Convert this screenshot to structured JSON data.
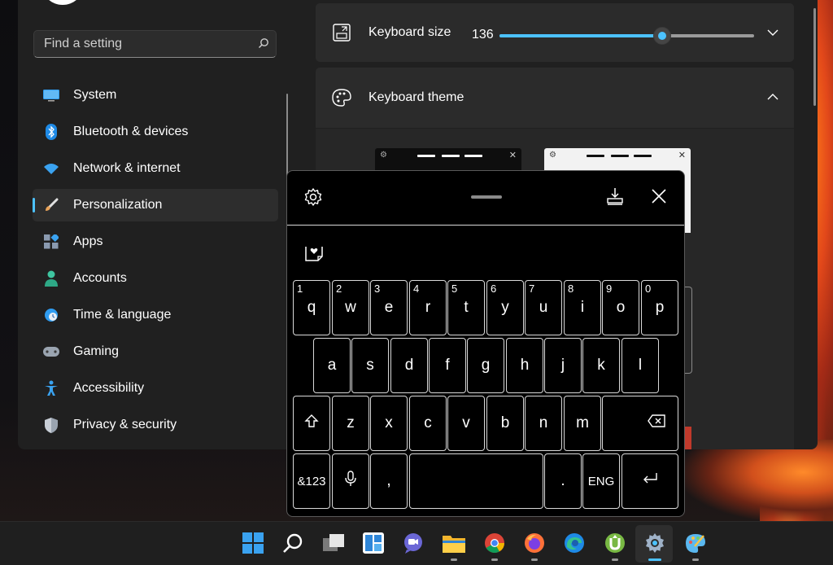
{
  "search": {
    "placeholder": "Find a setting"
  },
  "nav": {
    "items": [
      {
        "label": "System",
        "icon": "monitor-icon"
      },
      {
        "label": "Bluetooth & devices",
        "icon": "bluetooth-icon"
      },
      {
        "label": "Network & internet",
        "icon": "wifi-icon"
      },
      {
        "label": "Personalization",
        "icon": "brush-icon",
        "active": true
      },
      {
        "label": "Apps",
        "icon": "apps-icon"
      },
      {
        "label": "Accounts",
        "icon": "person-icon"
      },
      {
        "label": "Time & language",
        "icon": "globe-clock-icon"
      },
      {
        "label": "Gaming",
        "icon": "gamepad-icon"
      },
      {
        "label": "Accessibility",
        "icon": "accessibility-icon"
      },
      {
        "label": "Privacy & security",
        "icon": "shield-icon"
      }
    ]
  },
  "keyboard_size": {
    "label": "Keyboard size",
    "value": "136",
    "slider_fraction": 0.64
  },
  "keyboard_theme": {
    "label": "Keyboard theme"
  },
  "keyboard": {
    "row1": [
      {
        "num": "1",
        "char": "q"
      },
      {
        "num": "2",
        "char": "w"
      },
      {
        "num": "3",
        "char": "e"
      },
      {
        "num": "4",
        "char": "r"
      },
      {
        "num": "5",
        "char": "t"
      },
      {
        "num": "6",
        "char": "y"
      },
      {
        "num": "7",
        "char": "u"
      },
      {
        "num": "8",
        "char": "i"
      },
      {
        "num": "9",
        "char": "o"
      },
      {
        "num": "0",
        "char": "p"
      }
    ],
    "row2": [
      "a",
      "s",
      "d",
      "f",
      "g",
      "h",
      "j",
      "k",
      "l"
    ],
    "row3": [
      "z",
      "x",
      "c",
      "v",
      "b",
      "n",
      "m"
    ],
    "symbols_label": "&123",
    "comma": ",",
    "period": ".",
    "lang_label": "ENG"
  },
  "colors": {
    "accent": "#4cc2ff",
    "panel": "#202020",
    "card": "#2b2b2b"
  },
  "taskbar": {
    "icons": [
      "windows-start-icon",
      "search-icon",
      "task-view-icon",
      "widgets-icon",
      "teams-chat-icon",
      "file-explorer-icon",
      "chrome-icon",
      "firefox-icon",
      "edge-icon",
      "utorrent-icon",
      "settings-icon",
      "paint-icon"
    ]
  }
}
